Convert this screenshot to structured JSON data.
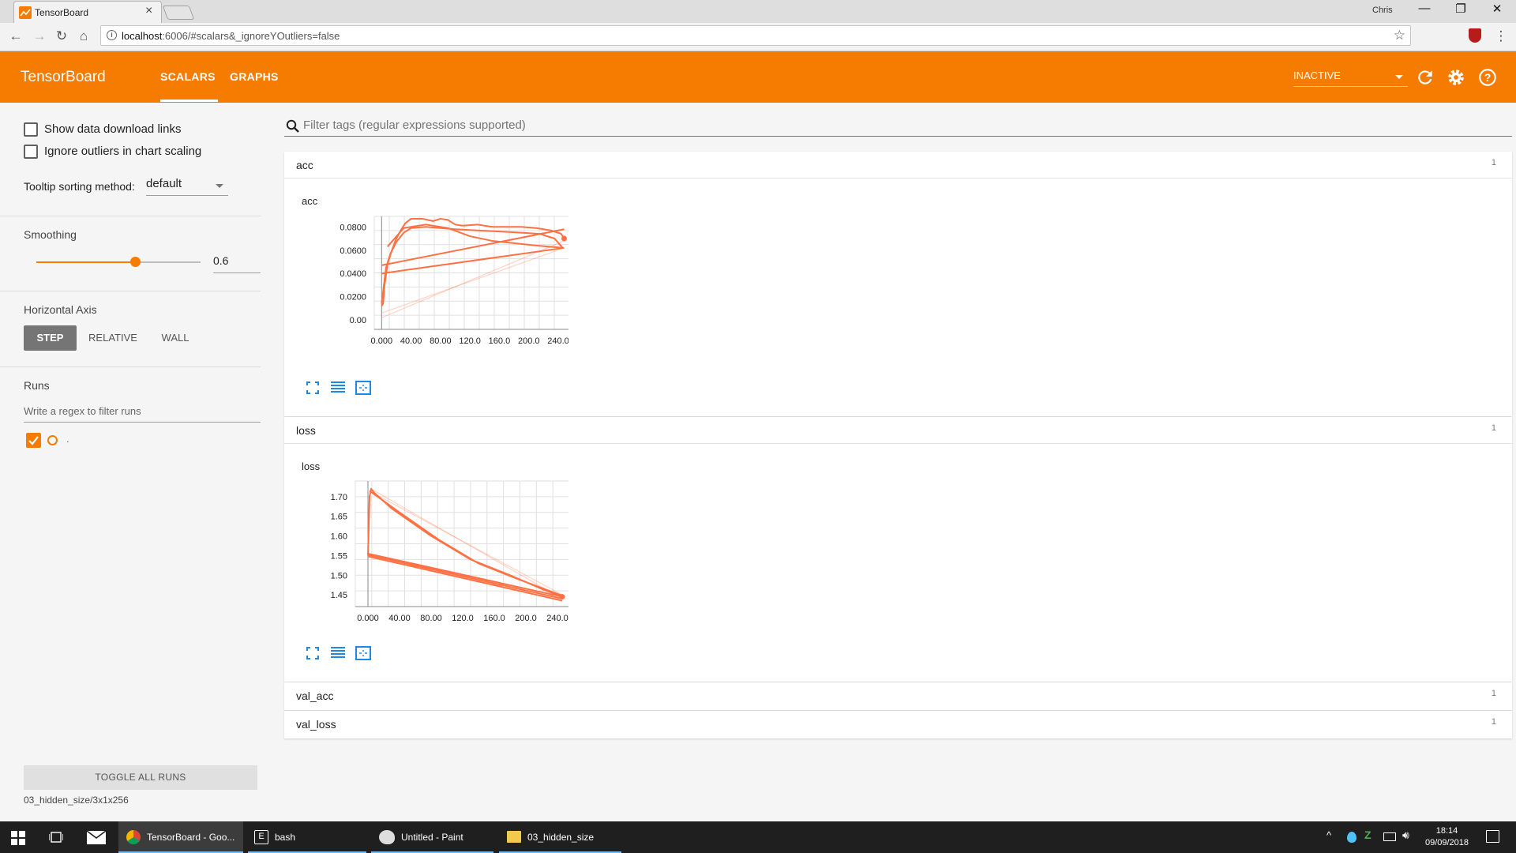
{
  "browser": {
    "tab_title": "TensorBoard",
    "tab_close": "×",
    "url_host": "localhost",
    "url_rest": ":6006/#scalars&_ignoreYOutliers=false",
    "profile": "Chris",
    "win_min": "—",
    "win_max": "❐",
    "win_close": "✕",
    "back": "←",
    "forward": "→",
    "reload": "↻",
    "home": "⌂",
    "star": "☆",
    "menu": "⋮"
  },
  "tensorboard": {
    "title": "TensorBoard",
    "tabs": [
      "SCALARS",
      "GRAPHS"
    ],
    "inactive_label": "INACTIVE",
    "accent": "#f57c00"
  },
  "sidebar": {
    "show_download": "Show data download links",
    "ignore_outliers": "Ignore outliers in chart scaling",
    "tooltip_label": "Tooltip sorting method:",
    "tooltip_value": "default",
    "smoothing_title": "Smoothing",
    "smoothing_value": "0.6",
    "smoothing_level": 0.6,
    "axis_title": "Horizontal Axis",
    "axis_buttons": [
      "STEP",
      "RELATIVE",
      "WALL"
    ],
    "runs_title": "Runs",
    "runs_filter_placeholder": "Write a regex to filter runs",
    "run_label": ".",
    "toggle_all": "TOGGLE ALL RUNS",
    "footer_path": "03_hidden_size/3x1x256"
  },
  "main": {
    "filter_placeholder": "Filter tags (regular expressions supported)",
    "cards": [
      {
        "title": "acc",
        "count": "1"
      },
      {
        "title": "loss",
        "count": "1"
      },
      {
        "title": "val_acc",
        "count": "1"
      },
      {
        "title": "val_loss",
        "count": "1"
      }
    ]
  },
  "chart_data": [
    {
      "type": "line",
      "title": "acc",
      "x_ticks": [
        "0.000",
        "40.00",
        "80.00",
        "120.0",
        "160.0",
        "200.0",
        "240.0"
      ],
      "y_ticks": [
        "0.00",
        "0.0200",
        "0.0400",
        "0.0600",
        "0.0800"
      ],
      "xlim": [
        -10,
        255
      ],
      "ylim": [
        -0.008,
        0.089
      ],
      "series": [
        {
          "values": [
            [
              0,
              0.012
            ],
            [
              2,
              0.014
            ],
            [
              4,
              0.03
            ],
            [
              8,
              0.048
            ],
            [
              14,
              0.06
            ],
            [
              20,
              0.07
            ],
            [
              26,
              0.077
            ],
            [
              32,
              0.083
            ],
            [
              40,
              0.087
            ],
            [
              55,
              0.087
            ],
            [
              70,
              0.085
            ],
            [
              80,
              0.087
            ],
            [
              90,
              0.086
            ],
            [
              100,
              0.082
            ],
            [
              110,
              0.081
            ],
            [
              130,
              0.082
            ],
            [
              150,
              0.08
            ],
            [
              170,
              0.08
            ],
            [
              190,
              0.08
            ],
            [
              210,
              0.079
            ],
            [
              230,
              0.077
            ],
            [
              244,
              0.074
            ],
            [
              248,
              0.07
            ]
          ]
        },
        {
          "values": [
            [
              0,
              0.014
            ],
            [
              6,
              0.045
            ],
            [
              12,
              0.057
            ],
            [
              20,
              0.067
            ],
            [
              30,
              0.075
            ],
            [
              40,
              0.079
            ],
            [
              60,
              0.08
            ],
            [
              80,
              0.079
            ],
            [
              100,
              0.078
            ],
            [
              130,
              0.077
            ],
            [
              160,
              0.076
            ],
            [
              190,
              0.075
            ],
            [
              215,
              0.074
            ],
            [
              235,
              0.07
            ],
            [
              246,
              0.062
            ]
          ]
        },
        {
          "values": [
            [
              0,
              0.047
            ],
            [
              248,
              0.078
            ]
          ]
        },
        {
          "values": [
            [
              0,
              0.04
            ],
            [
              248,
              0.062
            ]
          ]
        },
        {
          "values": [
            [
              8,
              0.063
            ],
            [
              30,
              0.079
            ],
            [
              60,
              0.082
            ],
            [
              90,
              0.079
            ],
            [
              120,
              0.072
            ],
            [
              150,
              0.068
            ],
            [
              180,
              0.066
            ],
            [
              210,
              0.064
            ],
            [
              246,
              0.062
            ]
          ]
        }
      ],
      "raw_series": [
        {
          "values": [
            [
              0,
              0.002
            ],
            [
              248,
              0.068
            ]
          ]
        },
        {
          "values": [
            [
              0,
              0.006
            ],
            [
              248,
              0.062
            ]
          ]
        }
      ],
      "end_point": [
        248,
        0.07
      ]
    },
    {
      "type": "line",
      "title": "loss",
      "x_ticks": [
        "0.000",
        "40.00",
        "80.00",
        "120.0",
        "160.0",
        "200.0",
        "240.0"
      ],
      "y_ticks": [
        "1.45",
        "1.50",
        "1.55",
        "1.60",
        "1.65",
        "1.70"
      ],
      "xlim": [
        -16,
        255
      ],
      "ylim": [
        1.42,
        1.74
      ],
      "series": [
        {
          "values": [
            [
              0,
              1.55
            ],
            [
              1,
              1.62
            ],
            [
              2,
              1.7
            ],
            [
              4,
              1.72
            ],
            [
              8,
              1.71
            ],
            [
              30,
              1.67
            ],
            [
              80,
              1.6
            ],
            [
              130,
              1.54
            ],
            [
              180,
              1.5
            ],
            [
              220,
              1.465
            ],
            [
              246,
              1.445
            ]
          ]
        },
        {
          "values": [
            [
              2,
              1.715
            ],
            [
              40,
              1.66
            ],
            [
              90,
              1.59
            ],
            [
              140,
              1.53
            ],
            [
              190,
              1.49
            ],
            [
              230,
              1.46
            ],
            [
              246,
              1.448
            ]
          ]
        },
        {
          "values": [
            [
              0,
              1.555
            ],
            [
              246,
              1.445
            ]
          ]
        },
        {
          "values": [
            [
              0,
              1.548
            ],
            [
              246,
              1.435
            ]
          ]
        },
        {
          "values": [
            [
              0,
              1.552
            ],
            [
              246,
              1.44
            ]
          ]
        }
      ],
      "raw_series": [
        {
          "values": [
            [
              4,
              1.72
            ],
            [
              246,
              1.44
            ]
          ]
        },
        {
          "values": [
            [
              6,
              1.71
            ],
            [
              246,
              1.45
            ]
          ]
        }
      ],
      "end_point": [
        246,
        1.445
      ]
    }
  ],
  "taskbar": {
    "items": [
      "TensorBoard - Goo...",
      "bash",
      "Untitled - Paint",
      "03_hidden_size"
    ],
    "time": "18:14",
    "date": "09/09/2018"
  }
}
